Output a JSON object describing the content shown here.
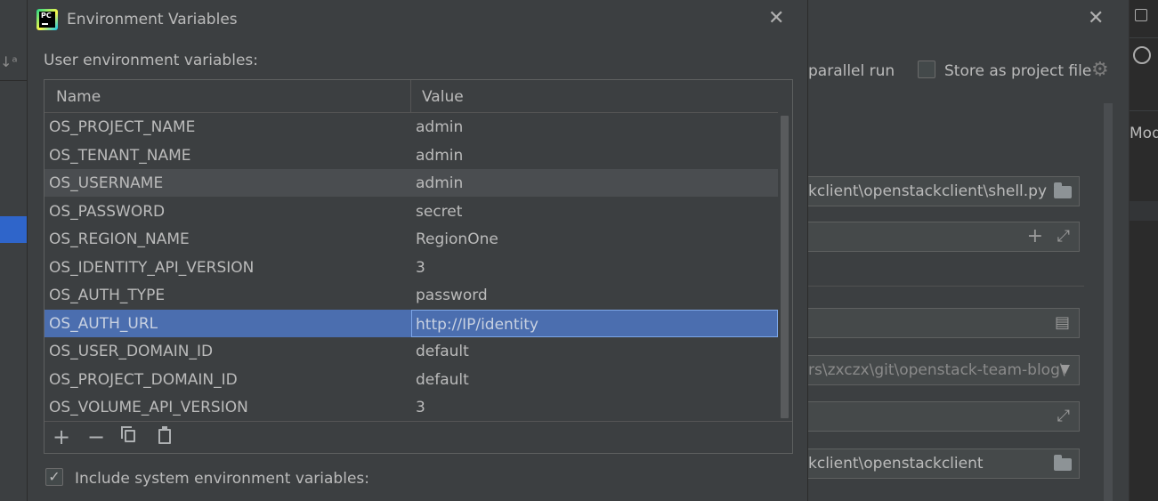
{
  "dialog": {
    "title": "Environment Variables",
    "section_label": "User environment variables:",
    "columns": [
      "Name",
      "Value"
    ],
    "rows": [
      {
        "name": "OS_PROJECT_NAME",
        "value": "admin"
      },
      {
        "name": "OS_TENANT_NAME",
        "value": "admin"
      },
      {
        "name": "OS_USERNAME",
        "value": "admin"
      },
      {
        "name": "OS_PASSWORD",
        "value": "secret"
      },
      {
        "name": "OS_REGION_NAME",
        "value": "RegionOne"
      },
      {
        "name": "OS_IDENTITY_API_VERSION",
        "value": "3"
      },
      {
        "name": "OS_AUTH_TYPE",
        "value": "password"
      },
      {
        "name": "OS_AUTH_URL",
        "value": "http://IP/identity"
      },
      {
        "name": "OS_USER_DOMAIN_ID",
        "value": "default"
      },
      {
        "name": "OS_PROJECT_DOMAIN_ID",
        "value": "default"
      },
      {
        "name": "OS_VOLUME_API_VERSION",
        "value": "3"
      }
    ],
    "hovered_row": 2,
    "selected_row": 7,
    "toolbar": {
      "add_symbol": "+",
      "remove_symbol": "−"
    },
    "include_system": {
      "checked": true,
      "check_glyph": "✓",
      "label": "Include system environment variables:"
    },
    "close_glyph": "✕",
    "app_icon_text": "PC"
  },
  "background": {
    "parallel_run_label": "parallel run",
    "store_as_project_file_label": "Store as project file",
    "script_path": "kclient\\openstackclient\\shell.py",
    "working_dir_dropdown": "rs\\zxczx\\git\\openstack-team-blog\\",
    "working_dir": "kclient\\openstackclient",
    "right_partial_text": "Mod",
    "close_glyph": "✕",
    "sort_glyph": "↓ᵃ"
  },
  "colors": {
    "dialog_bg": "#3c3f41",
    "selected_row": "#4b6eaf",
    "hover_row": "#4a4d50",
    "text": "#bbbbbb"
  }
}
